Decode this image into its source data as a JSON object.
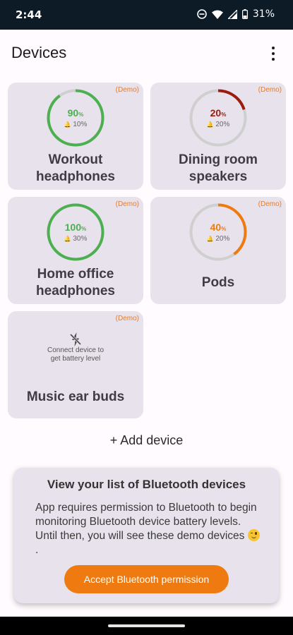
{
  "status_bar": {
    "time": "2:44",
    "battery": "31%"
  },
  "app_bar": {
    "title": "Devices"
  },
  "devices": [
    {
      "name_lines": [
        "Workout",
        "headphones"
      ],
      "demo": "(Demo)",
      "level": 90,
      "level_text": "90",
      "threshold": "10%",
      "color": "#4caf50"
    },
    {
      "name_lines": [
        "Dining room",
        "speakers"
      ],
      "demo": "(Demo)",
      "level": 20,
      "level_text": "20",
      "threshold": "20%",
      "color": "#9b1b0e"
    },
    {
      "name_lines": [
        "Home office",
        "headphones"
      ],
      "demo": "(Demo)",
      "level": 100,
      "level_text": "100",
      "threshold": "30%",
      "color": "#4caf50"
    },
    {
      "name_lines": [
        "Pods"
      ],
      "demo": "(Demo)",
      "level": 40,
      "level_text": "40",
      "threshold": "20%",
      "color": "#ef7a0f"
    },
    {
      "name_lines": [
        "Music ear buds"
      ],
      "demo": "(Demo)",
      "connect_lines": [
        "Connect device to",
        "get battery level"
      ]
    }
  ],
  "ring": {
    "percent_unit": "%",
    "track_color": "#cfcfcf",
    "bell_glyph": "🔔"
  },
  "add_device": "+ Add device",
  "permission": {
    "title": "View your list of Bluetooth devices",
    "body": "App requires permission to Bluetooth to begin monitoring Bluetooth device battery levels. Until then, you will see these demo devices",
    "emoji": "winking-face",
    "button": "Accept Bluetooth permission"
  },
  "colors": {
    "accent": "#ef7a0f",
    "card_bg": "#e8e2ec",
    "status_bg": "#0d1b26"
  }
}
